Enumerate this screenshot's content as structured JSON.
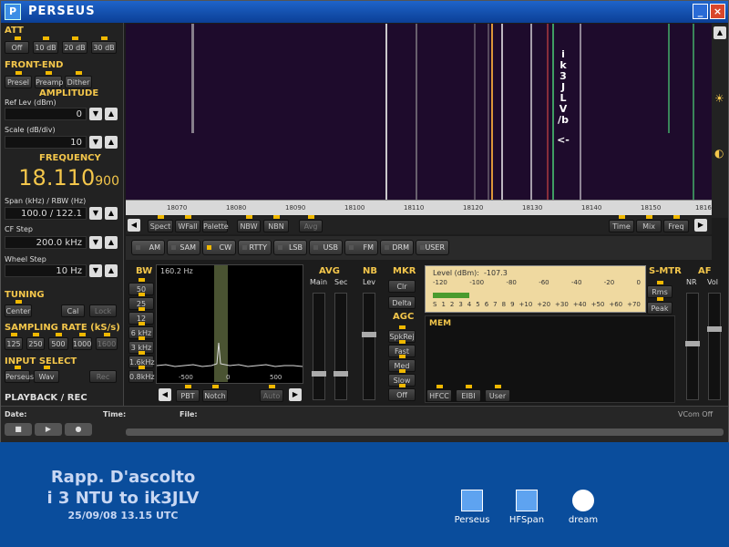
{
  "app": {
    "title": "PERSEUS"
  },
  "att": {
    "title": "ATT",
    "buttons": [
      "Off",
      "10 dB",
      "20 dB",
      "30 dB"
    ]
  },
  "frontend": {
    "title": "FRONT-END",
    "buttons": [
      "Presel",
      "Preamp",
      "Dither"
    ]
  },
  "amplitude": {
    "title": "AMPLITUDE",
    "ref_label": "Ref Lev (dBm)",
    "ref_value": "0",
    "scale_label": "Scale (dB/div)",
    "scale_value": "10"
  },
  "frequency": {
    "title": "FREQUENCY",
    "main": "18.110",
    "sub": "900",
    "span_label": "Span (kHz) / RBW (Hz)",
    "span_value": "100.0 / 122.1",
    "cf_label": "CF Step",
    "cf_value": "200.0 kHz",
    "wheel_label": "Wheel Step",
    "wheel_value": "10 Hz"
  },
  "tuning": {
    "title": "TUNING",
    "buttons": [
      "Center",
      "Cal",
      "Lock"
    ]
  },
  "sampling": {
    "title": "SAMPLING RATE (kS/s)",
    "buttons": [
      "125",
      "250",
      "500",
      "1000",
      "1600"
    ]
  },
  "input": {
    "title": "INPUT SELECT",
    "buttons": [
      "Perseus",
      "Wav",
      "Rec"
    ]
  },
  "playback": {
    "title": "PLAYBACK / REC",
    "date_label": "Date:",
    "time_label": "Time:",
    "file_label": "File:",
    "vcom": "VCom Off"
  },
  "waterfall": {
    "text": [
      "i",
      "k",
      "3",
      "J",
      "L",
      "V",
      "/b",
      "<-"
    ]
  },
  "ruler": {
    "ticks": [
      "18070",
      "18080",
      "18090",
      "18100",
      "18110",
      "18120",
      "18130",
      "18140",
      "18150",
      "1816"
    ]
  },
  "spectrum_buttons": [
    "Spect",
    "WFall",
    "Palette",
    "NBW",
    "NBN",
    "Avg"
  ],
  "spectrum_right": [
    "Time",
    "Mix",
    "Freq"
  ],
  "modes": [
    "AM",
    "SAM",
    "CW",
    "RTTY",
    "LSB",
    "USB",
    "FM",
    "DRM",
    "USER"
  ],
  "active_mode": "CW",
  "bw": {
    "title": "BW",
    "items": [
      "50 kHz",
      "25 kHz",
      "12 kHz",
      "6 kHz",
      "3 kHz",
      "1.6kHz",
      "0.8kHz"
    ],
    "value": "160.2 Hz",
    "ticks": [
      "-500",
      "0",
      "500"
    ],
    "pbt": "PBT",
    "notch": "Notch",
    "auto": "Auto"
  },
  "avg": {
    "title": "AVG",
    "labels": [
      "Main",
      "Sec"
    ]
  },
  "nb": {
    "title": "NB",
    "label": "Lev"
  },
  "mkr": {
    "title": "MKR",
    "buttons": [
      "Clr",
      "Delta"
    ]
  },
  "agc": {
    "title": "AGC",
    "buttons": [
      "SpkRej",
      "Fast",
      "Med",
      "Slow",
      "Off"
    ]
  },
  "level": {
    "label": "Level (dBm):",
    "value": "-107.3",
    "scale_top": [
      "-120",
      "-100",
      "-80",
      "-60",
      "-40",
      "-20",
      "0"
    ],
    "scale_bottom": [
      "S",
      "1",
      "2",
      "3",
      "4",
      "5",
      "6",
      "7",
      "8",
      "9",
      "+10",
      "+20",
      "+30",
      "+40",
      "+50",
      "+60",
      "+70"
    ]
  },
  "smtr": {
    "title": "S-MTR",
    "buttons": [
      "Rms",
      "Peak"
    ]
  },
  "af": {
    "title": "AF",
    "labels": [
      "NR",
      "Vol"
    ]
  },
  "mem": {
    "title": "MEM",
    "buttons": [
      "HFCC",
      "EIBI",
      "User"
    ]
  },
  "desktop": {
    "line1": "Rapp. D'ascolto",
    "line2": "i 3 NTU to ik3JLV",
    "line3": "25/09/08  13.15 UTC",
    "icons": [
      "Perseus",
      "HFSpan",
      "dream"
    ]
  },
  "colors": {
    "accent": "#f3c64b",
    "desktop": "#0a4d9c",
    "led": "#f0b800"
  }
}
